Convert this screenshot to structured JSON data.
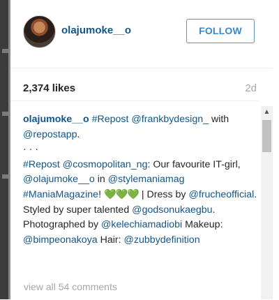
{
  "post": {
    "username": "olajumoke__o",
    "follow_label": "FOLLOW",
    "likes": "2,374 likes",
    "time_ago": "2d"
  },
  "caption": {
    "author": "olajumoke__o",
    "segments": [
      {
        "t": "#Repost",
        "link": true
      },
      {
        "t": " ",
        "link": false
      },
      {
        "t": "@frankbydesign_",
        "link": true
      },
      {
        "t": " with ",
        "link": false
      },
      {
        "t": "@repostapp",
        "link": true
      },
      {
        "t": ".",
        "link": false
      },
      {
        "br": true
      },
      {
        "t": "· · ·",
        "link": false
      },
      {
        "br": true
      },
      {
        "t": "#Repost",
        "link": true
      },
      {
        "t": " ",
        "link": false
      },
      {
        "t": "@cosmopolitan_ng",
        "link": true
      },
      {
        "t": ": Our favourite IT-girl, ",
        "link": false
      },
      {
        "t": "@olajumoke__o",
        "link": true
      },
      {
        "t": " in ",
        "link": false
      },
      {
        "t": "@stylemaniamag",
        "link": true
      },
      {
        "t": " ",
        "link": false
      },
      {
        "t": "#ManiaMagazine",
        "link": true
      },
      {
        "t": "! ",
        "link": false
      },
      {
        "t": "💚💚💚",
        "link": false,
        "hearts": true
      },
      {
        "t": " | Dress by ",
        "link": false
      },
      {
        "t": "@frucheofficial",
        "link": true
      },
      {
        "t": ". Styled by super talented ",
        "link": false
      },
      {
        "t": "@godsonukaegbu",
        "link": true
      },
      {
        "t": ". Photographed by ",
        "link": false
      },
      {
        "t": "@kelechiamadiobi",
        "link": true
      },
      {
        "t": " Makeup: ",
        "link": false
      },
      {
        "t": "@bimpeonakoya",
        "link": true
      },
      {
        "t": " Hair: ",
        "link": false
      },
      {
        "t": "@zubbydefinition",
        "link": true
      }
    ]
  },
  "comments": {
    "view_all": "view all 54 comments"
  },
  "scrollbar": {
    "up_arrow": "▲"
  },
  "colors": {
    "link": "#125688",
    "follow_border": "#5b93c7",
    "muted": "#a5a7aa",
    "hearts": "#3fbf2b"
  }
}
